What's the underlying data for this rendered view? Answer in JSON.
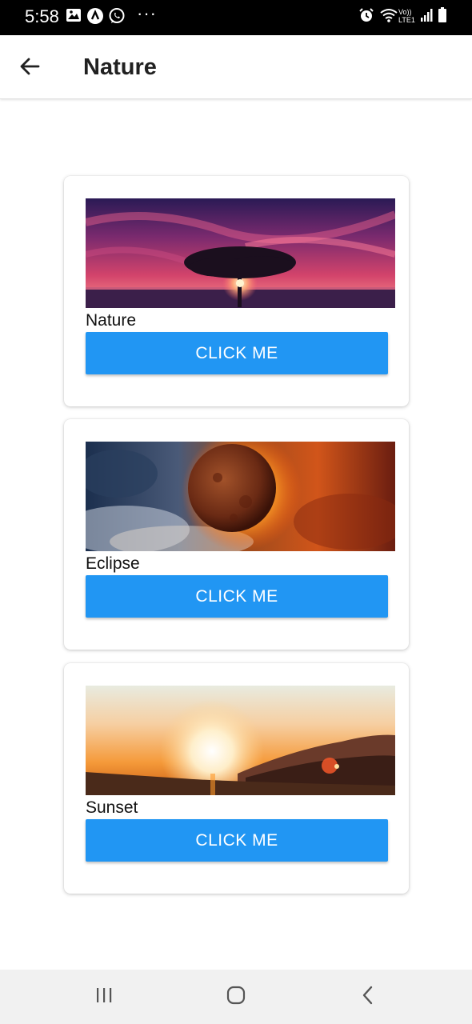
{
  "status_bar": {
    "time": "5:58",
    "icons_left": [
      "gallery-icon",
      "app-a-icon",
      "whatsapp-icon"
    ],
    "overflow": "···",
    "network_label_top": "Vo))",
    "network_label_bottom": "LTE1",
    "icons_right": [
      "alarm-icon",
      "wifi-icon",
      "signal-icon",
      "battery-icon"
    ]
  },
  "app_bar": {
    "title": "Nature",
    "back_icon": "arrow-back-icon"
  },
  "cards": [
    {
      "title": "Nature",
      "button_label": "CLICK ME",
      "image": "tree-sunset-purple-sky"
    },
    {
      "title": "Eclipse",
      "button_label": "CLICK ME",
      "image": "solar-eclipse-planet"
    },
    {
      "title": "Sunset",
      "button_label": "CLICK ME",
      "image": "sunset-over-hills"
    }
  ],
  "nav_bar": {
    "icons": [
      "recent-apps-icon",
      "home-icon",
      "back-nav-icon"
    ]
  },
  "colors": {
    "button": "#2196f3",
    "status_bar": "#000000",
    "nav_bar": "#f1f1f1"
  }
}
